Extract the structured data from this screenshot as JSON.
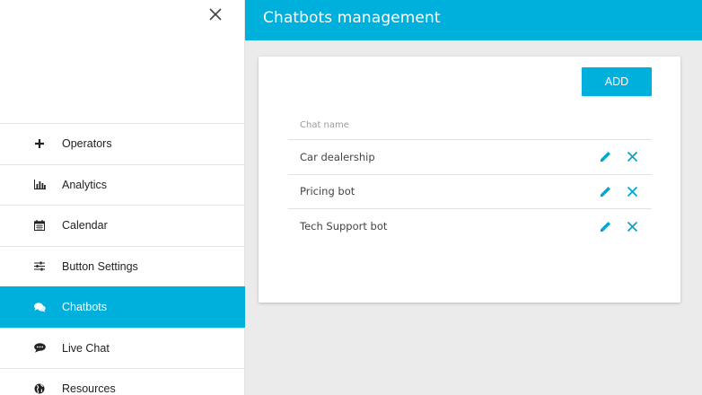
{
  "sidebar": {
    "close_icon": "close-icon",
    "items": [
      {
        "label": "Operators",
        "icon": "plus-icon",
        "active": false
      },
      {
        "label": "Analytics",
        "icon": "bar-chart-icon",
        "active": false
      },
      {
        "label": "Calendar",
        "icon": "calendar-icon",
        "active": false
      },
      {
        "label": "Button Settings",
        "icon": "sliders-icon",
        "active": false
      },
      {
        "label": "Chatbots",
        "icon": "chat-bubbles-icon",
        "active": true
      },
      {
        "label": "Live Chat",
        "icon": "comment-icon",
        "active": false
      },
      {
        "label": "Resources",
        "icon": "globe-icon",
        "active": false
      }
    ]
  },
  "header": {
    "title": "Chatbots management"
  },
  "card": {
    "add_label": "ADD",
    "column_header": "Chat name",
    "rows": [
      {
        "name": "Car dealership"
      },
      {
        "name": "Pricing bot"
      },
      {
        "name": "Tech Support bot"
      }
    ]
  },
  "colors": {
    "accent": "#00b0dc",
    "background": "#ebebeb"
  }
}
